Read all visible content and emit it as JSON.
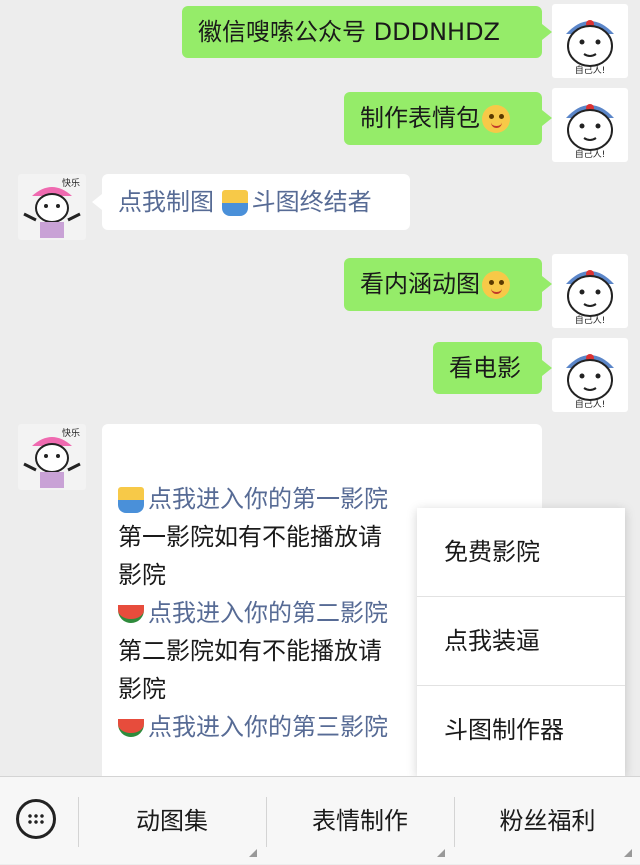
{
  "messages": [
    {
      "text": "徽信嗖嗦公众号 DDDNHDZ"
    },
    {
      "text": "制作表情包"
    },
    {
      "text_a": "点我制图",
      "text_b": "斗图终结者"
    },
    {
      "text": "看内涵动图"
    },
    {
      "text": "看电影"
    }
  ],
  "avatar_self_label": "自己人!",
  "avatar_bot_label": "快乐",
  "article": {
    "lines": [
      {
        "text": "点我进入你的第一影院",
        "link": true,
        "icon": "popcorn-icon"
      },
      {
        "text": "第一影院如有不能播放请",
        "link": false
      },
      {
        "text": "影院",
        "link": false
      },
      {
        "text": "点我进入你的第二影院",
        "link": true,
        "icon": "watermelon-icon"
      },
      {
        "text": "第二影院如有不能播放请",
        "link": false
      },
      {
        "text": "影院",
        "link": false
      },
      {
        "text": "点我进入你的第三影院",
        "link": true,
        "icon": "watermelon-icon"
      }
    ]
  },
  "popup": {
    "items": [
      "免费影院",
      "点我装逼",
      "斗图制作器"
    ]
  },
  "bottom_menu": {
    "items": [
      "动图集",
      "表情制作",
      "粉丝福利"
    ]
  },
  "colors": {
    "outgoing_bubble": "#95ec69",
    "incoming_bubble": "#ffffff",
    "link": "#576b95",
    "background": "#ededed"
  }
}
